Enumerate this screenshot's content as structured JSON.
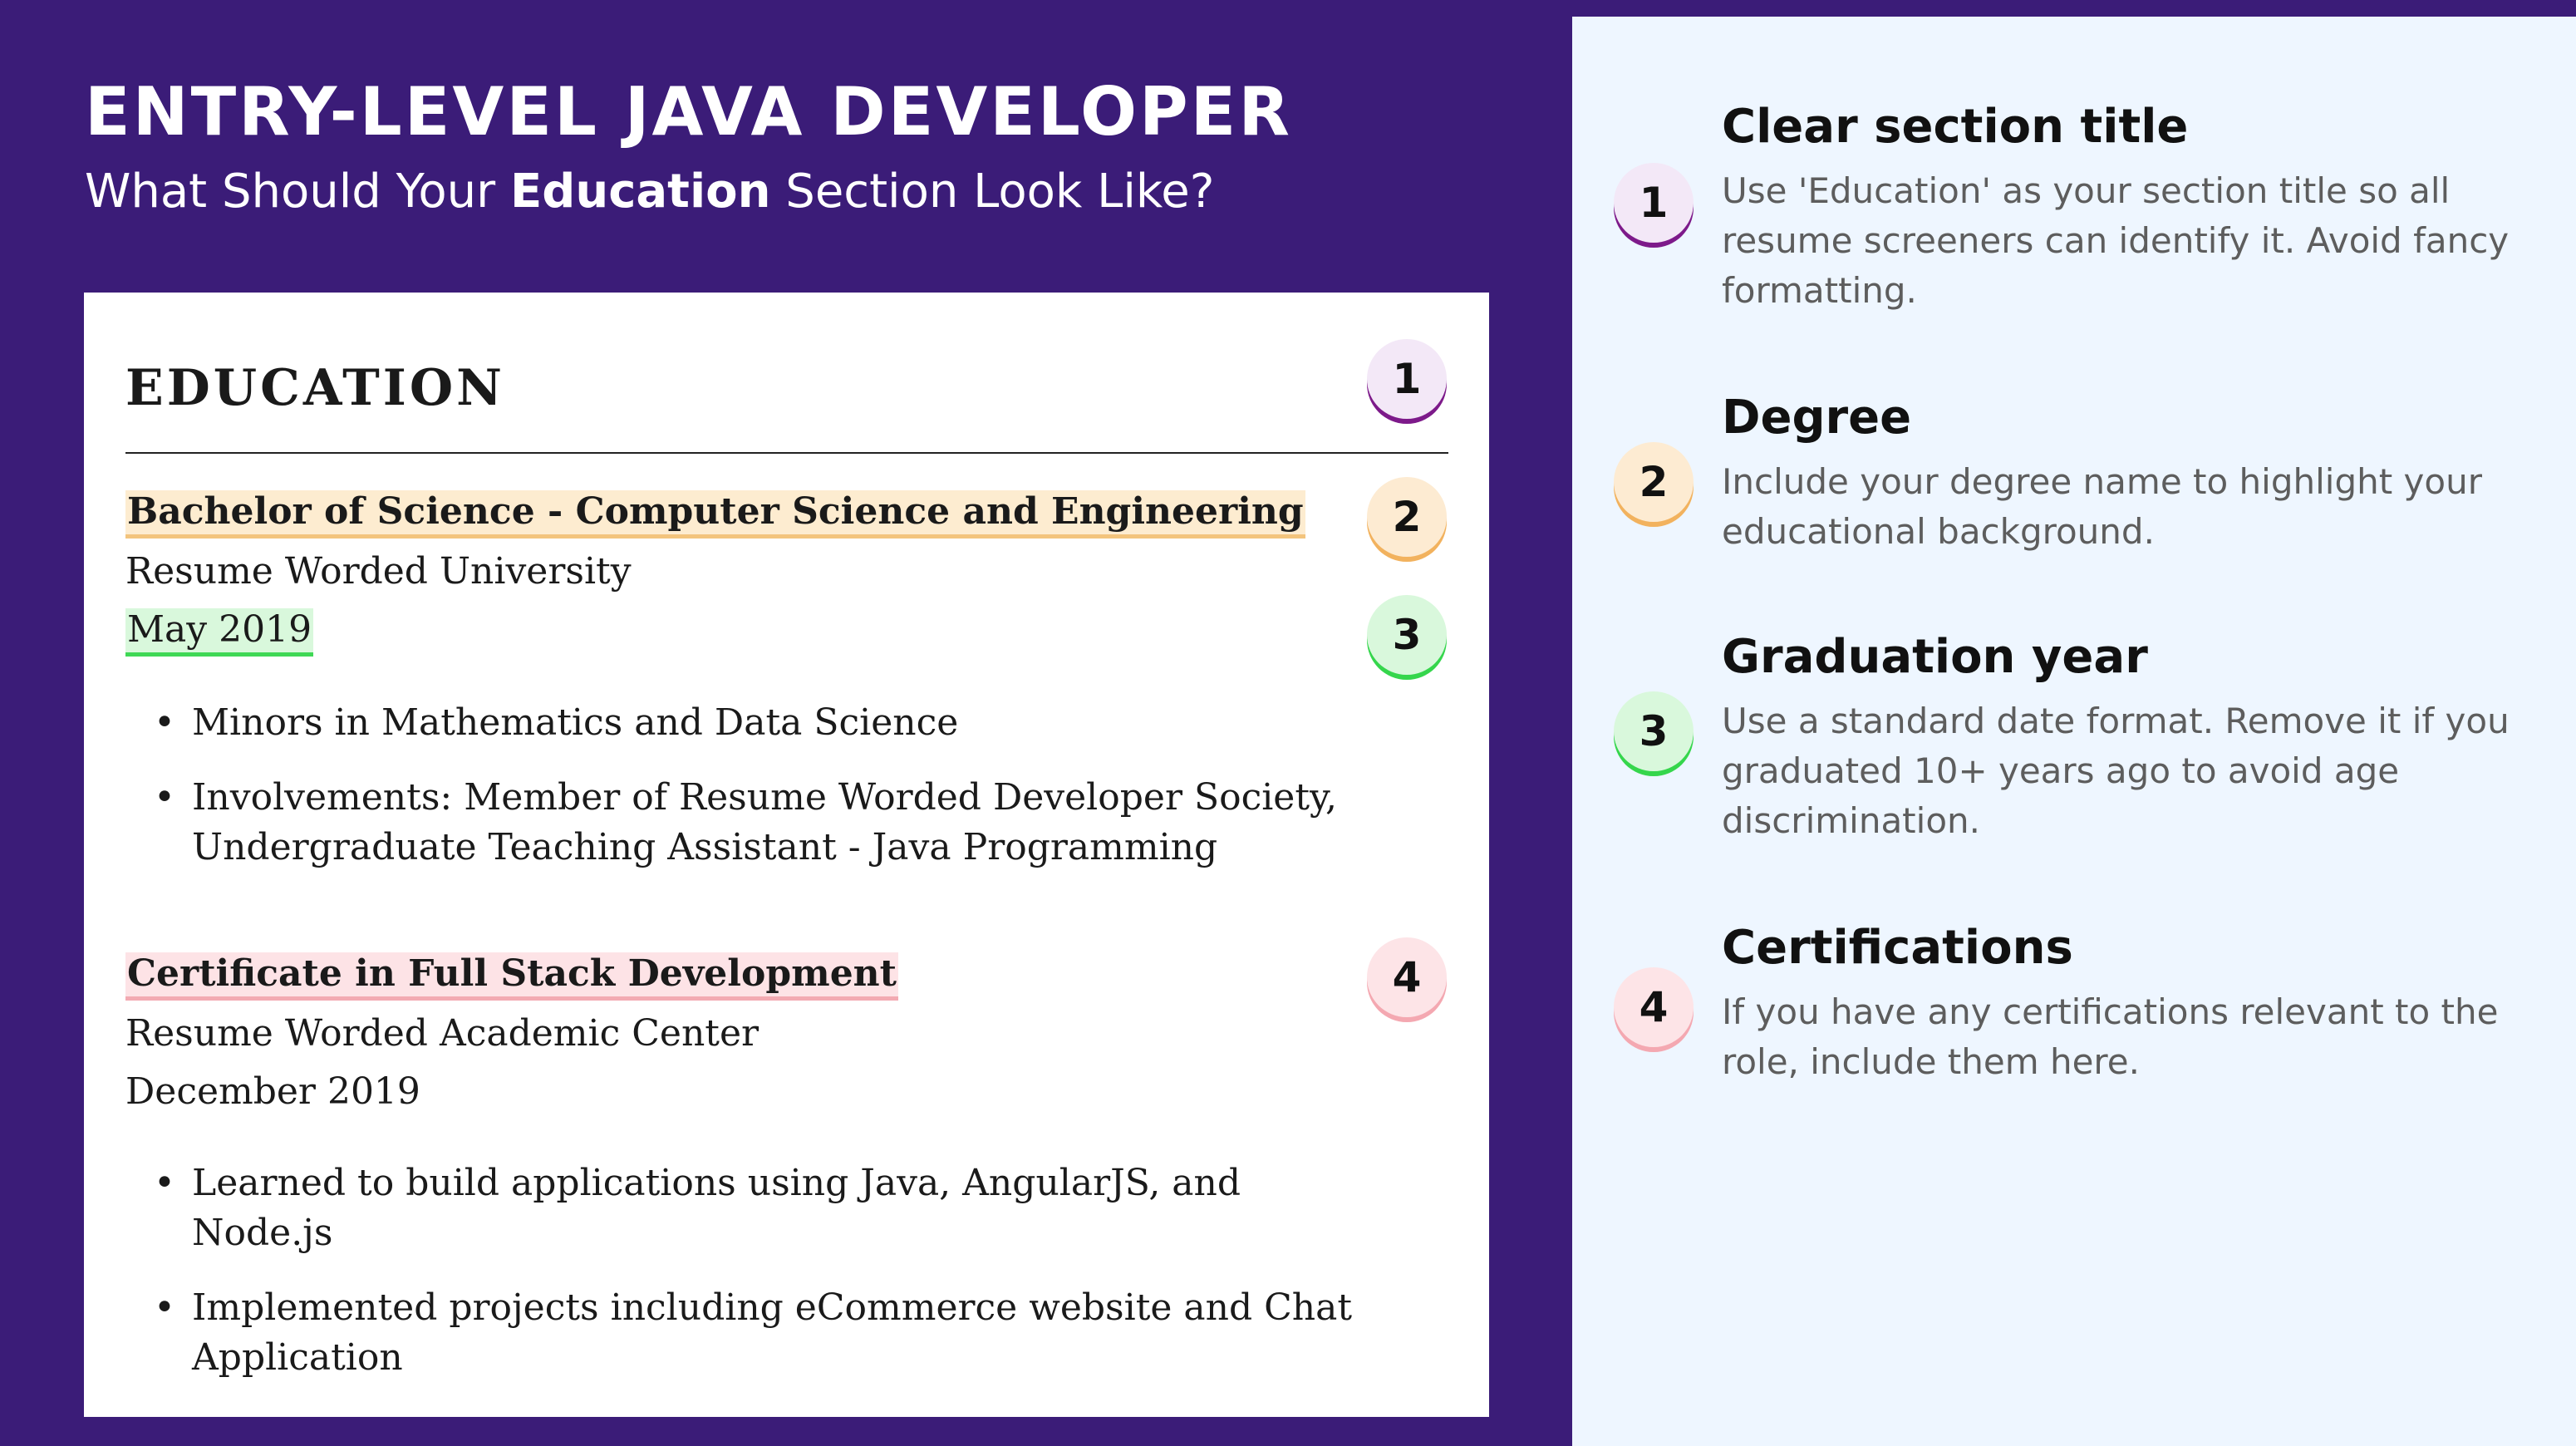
{
  "header": {
    "title": "ENTRY-LEVEL JAVA DEVELOPER",
    "subtitle_before": "What Should Your ",
    "subtitle_bold": "Education",
    "subtitle_after": " Section Look Like?"
  },
  "resume": {
    "section_title": "EDUCATION",
    "entries": [
      {
        "degree": "Bachelor of Science - Computer Science and Engineering",
        "institution": "Resume Worded University",
        "date": "May 2019",
        "bullets": [
          "Minors in Mathematics and Data Science",
          "Involvements: Member of Resume Worded Developer Society, Undergraduate Teaching Assistant - Java Programming"
        ]
      },
      {
        "degree": "Certificate in Full Stack Development",
        "institution": "Resume Worded Academic Center",
        "date": "December 2019",
        "bullets": [
          "Learned to build applications using Java, AngularJS, and Node.js",
          "Implemented projects including eCommerce website and Chat Application"
        ]
      }
    ]
  },
  "badges": [
    "1",
    "2",
    "3",
    "4"
  ],
  "tips": [
    {
      "number": "1",
      "heading": "Clear section title",
      "body": "Use 'Education' as your section title so all resume screeners can identify it. Avoid fancy formatting."
    },
    {
      "number": "2",
      "heading": "Degree",
      "body": "Include your degree name to highlight your educational background."
    },
    {
      "number": "3",
      "heading": "Graduation year",
      "body": "Use a standard date format. Remove it if you graduated 10+ years ago to avoid age discrimination."
    },
    {
      "number": "4",
      "heading": "Certifications",
      "body": "If you have any certifications relevant to the role, include them here."
    }
  ],
  "colors": {
    "background": "#3b1c78",
    "panel": "#eef6ff",
    "badge_1": "#7d1a8a",
    "badge_2": "#f2b25e",
    "badge_3": "#35d64c",
    "badge_4": "#f4a8b1"
  }
}
